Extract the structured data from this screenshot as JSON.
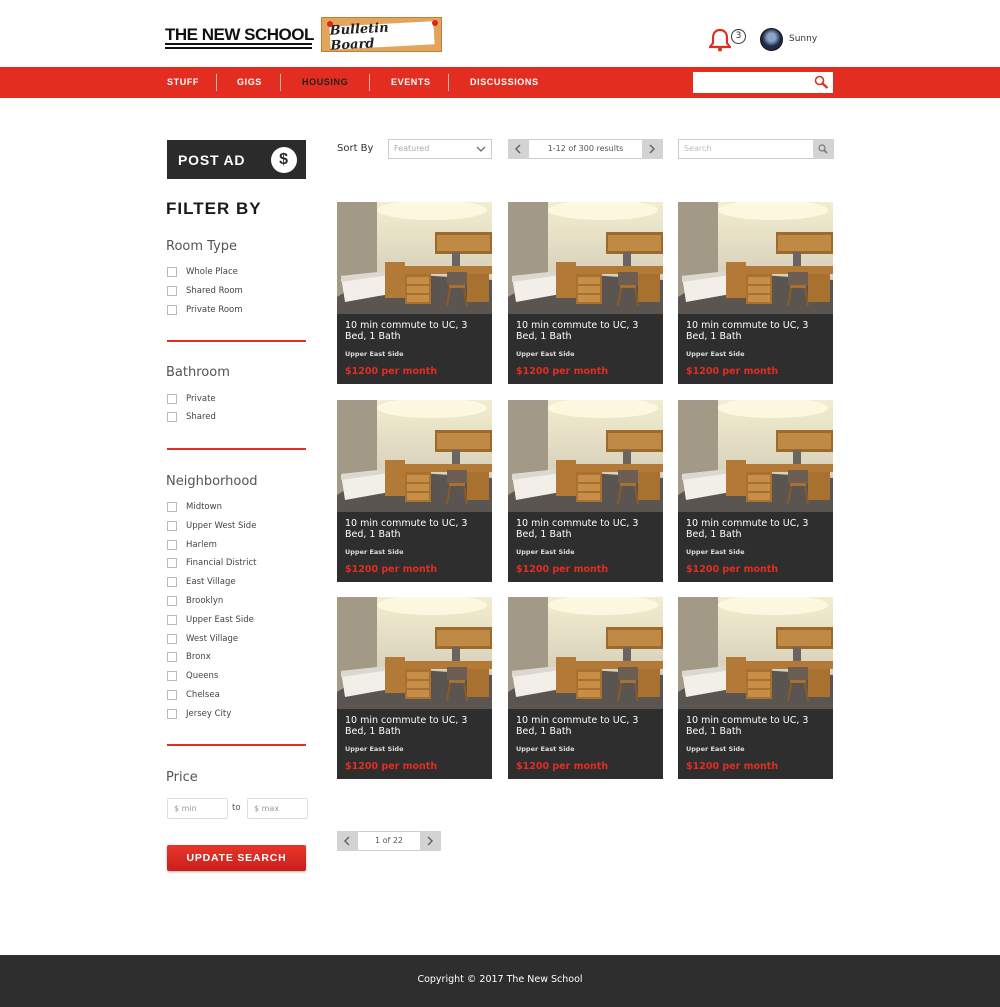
{
  "header": {
    "logo": "THE NEW SCHOOL",
    "board_logo": "Bulletin Board",
    "notification_count": "3",
    "username": "Sunny"
  },
  "nav": {
    "items": [
      {
        "label": "STUFF"
      },
      {
        "label": "GIGS"
      },
      {
        "label": "HOUSING",
        "active": true
      },
      {
        "label": "EVENTS"
      },
      {
        "label": "DISCUSSIONS"
      }
    ],
    "search_placeholder": ""
  },
  "sidebar": {
    "post_ad": "POST AD",
    "filter_title": "FILTER BY",
    "room_type": {
      "title": "Room Type",
      "options": [
        "Whole Place",
        "Shared Room",
        "Private Room"
      ]
    },
    "bathroom": {
      "title": "Bathroom",
      "options": [
        "Private",
        "Shared"
      ]
    },
    "neighborhood": {
      "title": "Neighborhood",
      "options": [
        "Midtown",
        "Upper West Side",
        "Harlem",
        "Financial District",
        "East Village",
        "Brooklyn",
        "Upper East Side",
        "West Village",
        "Bronx",
        "Queens",
        "Chelsea",
        "Jersey City"
      ]
    },
    "price": {
      "title": "Price",
      "min_placeholder": "$ min",
      "to": "to",
      "max_placeholder": "$ max"
    },
    "update_button": "UPDATE SEARCH"
  },
  "toolbar": {
    "sort_label": "Sort By",
    "sort_value": "Featured",
    "results": "1-12 of 300 results",
    "search_placeholder": "Search"
  },
  "listings": [
    {
      "title": "10 min commute to UC, 3 Bed, 1 Bath",
      "neighborhood": "Upper East Side",
      "price": "$1200 per month"
    },
    {
      "title": "10 min commute to UC, 3 Bed, 1 Bath",
      "neighborhood": "Upper East Side",
      "price": "$1200 per month"
    },
    {
      "title": "10 min commute to UC, 3 Bed, 1 Bath",
      "neighborhood": "Upper East Side",
      "price": "$1200 per month"
    },
    {
      "title": "10 min commute to UC, 3 Bed, 1 Bath",
      "neighborhood": "Upper East Side",
      "price": "$1200 per month"
    },
    {
      "title": "10 min commute to UC, 3 Bed, 1 Bath",
      "neighborhood": "Upper East Side",
      "price": "$1200 per month"
    },
    {
      "title": "10 min commute to UC, 3 Bed, 1 Bath",
      "neighborhood": "Upper East Side",
      "price": "$1200 per month"
    },
    {
      "title": "10 min commute to UC, 3 Bed, 1 Bath",
      "neighborhood": "Upper East Side",
      "price": "$1200 per month"
    },
    {
      "title": "10 min commute to UC, 3 Bed, 1 Bath",
      "neighborhood": "Upper East Side",
      "price": "$1200 per month"
    },
    {
      "title": "10 min commute to UC, 3 Bed, 1 Bath",
      "neighborhood": "Upper East Side",
      "price": "$1200 per month"
    }
  ],
  "pagination": {
    "page_text": "1 of 22"
  },
  "footer": {
    "copyright": "Copyright © 2017 The New School"
  },
  "colors": {
    "accent": "#e22d20",
    "dark": "#2e2e2e"
  }
}
